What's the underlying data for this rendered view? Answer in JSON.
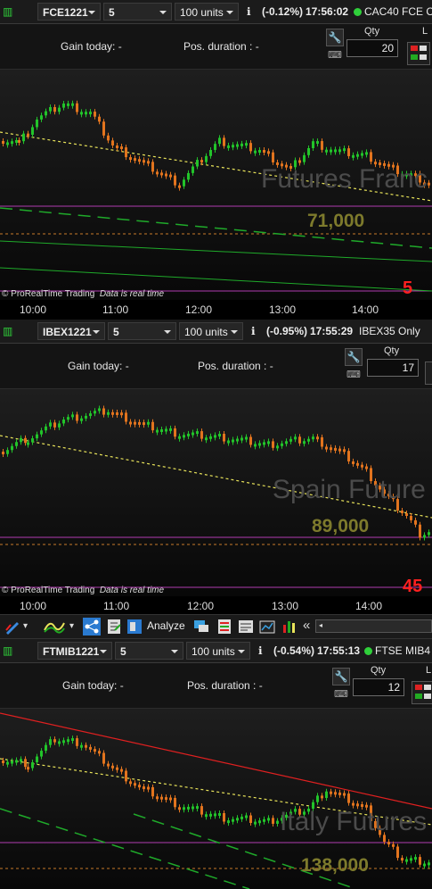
{
  "panels": [
    {
      "symbol": "FCE1221",
      "interval": "5 minutes",
      "units": "100 units",
      "change": "(-0.12%)",
      "time": "17:56:02",
      "instrument": "CAC40 FCE C",
      "gain_label": "Gain today:",
      "gain_value": "-",
      "pos_label": "Pos. duration :",
      "pos_value": "-",
      "qty_label": "Qty",
      "qty": "20",
      "watermark": "Futures Franc",
      "price_label": "71,000",
      "red_label": "5",
      "copyright": "© ProRealTime Trading",
      "realtime": "Data is real time",
      "axis": [
        "10:00",
        "11:00",
        "12:00",
        "13:00",
        "14:00"
      ]
    },
    {
      "symbol": "IBEX1221",
      "interval": "5 minutes",
      "units": "100 units",
      "change": "(-0.95%)",
      "time": "17:55:29",
      "instrument": "IBEX35 Only",
      "gain_label": "Gain today:",
      "gain_value": "-",
      "pos_label": "Pos. duration :",
      "pos_value": "-",
      "qty_label": "Qty",
      "qty": "17",
      "watermark": "Spain Future",
      "price_label": "89,000",
      "red_label": "45",
      "copyright": "© ProRealTime Trading",
      "realtime": "Data is real time",
      "axis": [
        "10:00",
        "11:00",
        "12:00",
        "13:00",
        "14:00"
      ]
    },
    {
      "symbol": "FTMIB1221",
      "interval": "5 minutes",
      "units": "100 units",
      "change": "(-0.54%)",
      "time": "17:55:13",
      "instrument": "FTSE MIB4",
      "gain_label": "Gain today:",
      "gain_value": "-",
      "pos_label": "Pos. duration :",
      "pos_value": "-",
      "qty_label": "Qty",
      "qty": "12",
      "watermark": "Italy Futures",
      "price_label": "138,000"
    }
  ],
  "toolbar": {
    "analyze_label": "Analyze",
    "overflow": "«"
  },
  "colors": {
    "up": "#22c42a",
    "down": "#e2741e",
    "trend": "#e8e35a",
    "green_line": "#1faa2a",
    "magenta": "#b03cb0",
    "red_line": "#e02020",
    "orange_dash": "#c87a2a"
  }
}
